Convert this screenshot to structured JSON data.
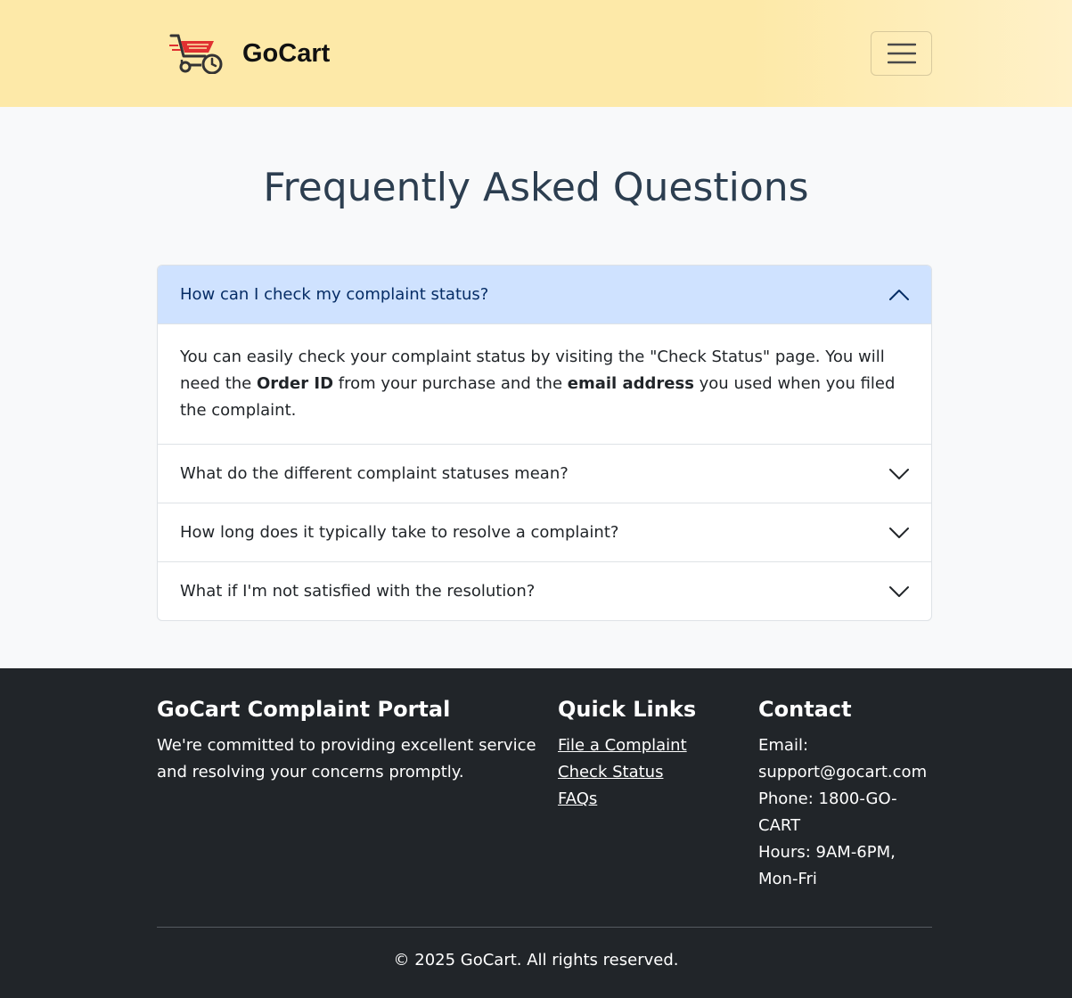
{
  "navbar": {
    "brand_name": "GoCart",
    "logo_icon": "shopping-cart-icon",
    "menu_icon": "hamburger-menu-icon"
  },
  "page": {
    "title": "Frequently Asked Questions"
  },
  "faq": {
    "items": [
      {
        "question": "How can I check my complaint status?",
        "expanded": true,
        "answer_part1": "You can easily check your complaint status by visiting the \"Check Status\" page. You will need the ",
        "answer_bold1": "Order ID",
        "answer_part2": " from your purchase and the ",
        "answer_bold2": "email address",
        "answer_part3": " you used when you filed the complaint."
      },
      {
        "question": "What do the different complaint statuses mean?",
        "expanded": false
      },
      {
        "question": "How long does it typically take to resolve a complaint?",
        "expanded": false
      },
      {
        "question": "What if I'm not satisfied with the resolution?",
        "expanded": false
      }
    ]
  },
  "footer": {
    "about": {
      "heading": "GoCart Complaint Portal",
      "text": "We're committed to providing excellent service and resolving your concerns promptly."
    },
    "links": {
      "heading": "Quick Links",
      "items": [
        "File a Complaint",
        "Check Status",
        "FAQs"
      ]
    },
    "contact": {
      "heading": "Contact",
      "email": "Email: support@gocart.com",
      "phone": "Phone: 1800-GO-CART",
      "hours": "Hours: 9AM-6PM, Mon-Fri"
    },
    "copyright": "© 2025 GoCart. All rights reserved."
  },
  "colors": {
    "navbar_bg": "#fde9a8",
    "accordion_active_bg": "#cfe2ff",
    "footer_bg": "#212529",
    "title_color": "#2c3e50",
    "logo_accent": "#e03131"
  }
}
